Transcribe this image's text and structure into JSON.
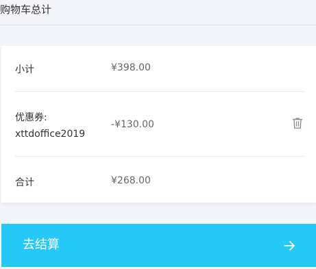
{
  "header": {
    "title": "购物车总计"
  },
  "summary": {
    "subtotal": {
      "label": "小计",
      "value": "¥398.00"
    },
    "coupon": {
      "label": "优惠券:",
      "code": "xttdoffice2019",
      "value": "-¥130.00",
      "remove_icon": "trash-icon"
    },
    "total": {
      "label": "合计",
      "value": "¥268.00"
    }
  },
  "checkout": {
    "label": "去结算",
    "icon": "arrow-right-icon"
  },
  "colors": {
    "accent": "#24c9f7",
    "background": "#f4f5fa",
    "card": "#ffffff"
  }
}
